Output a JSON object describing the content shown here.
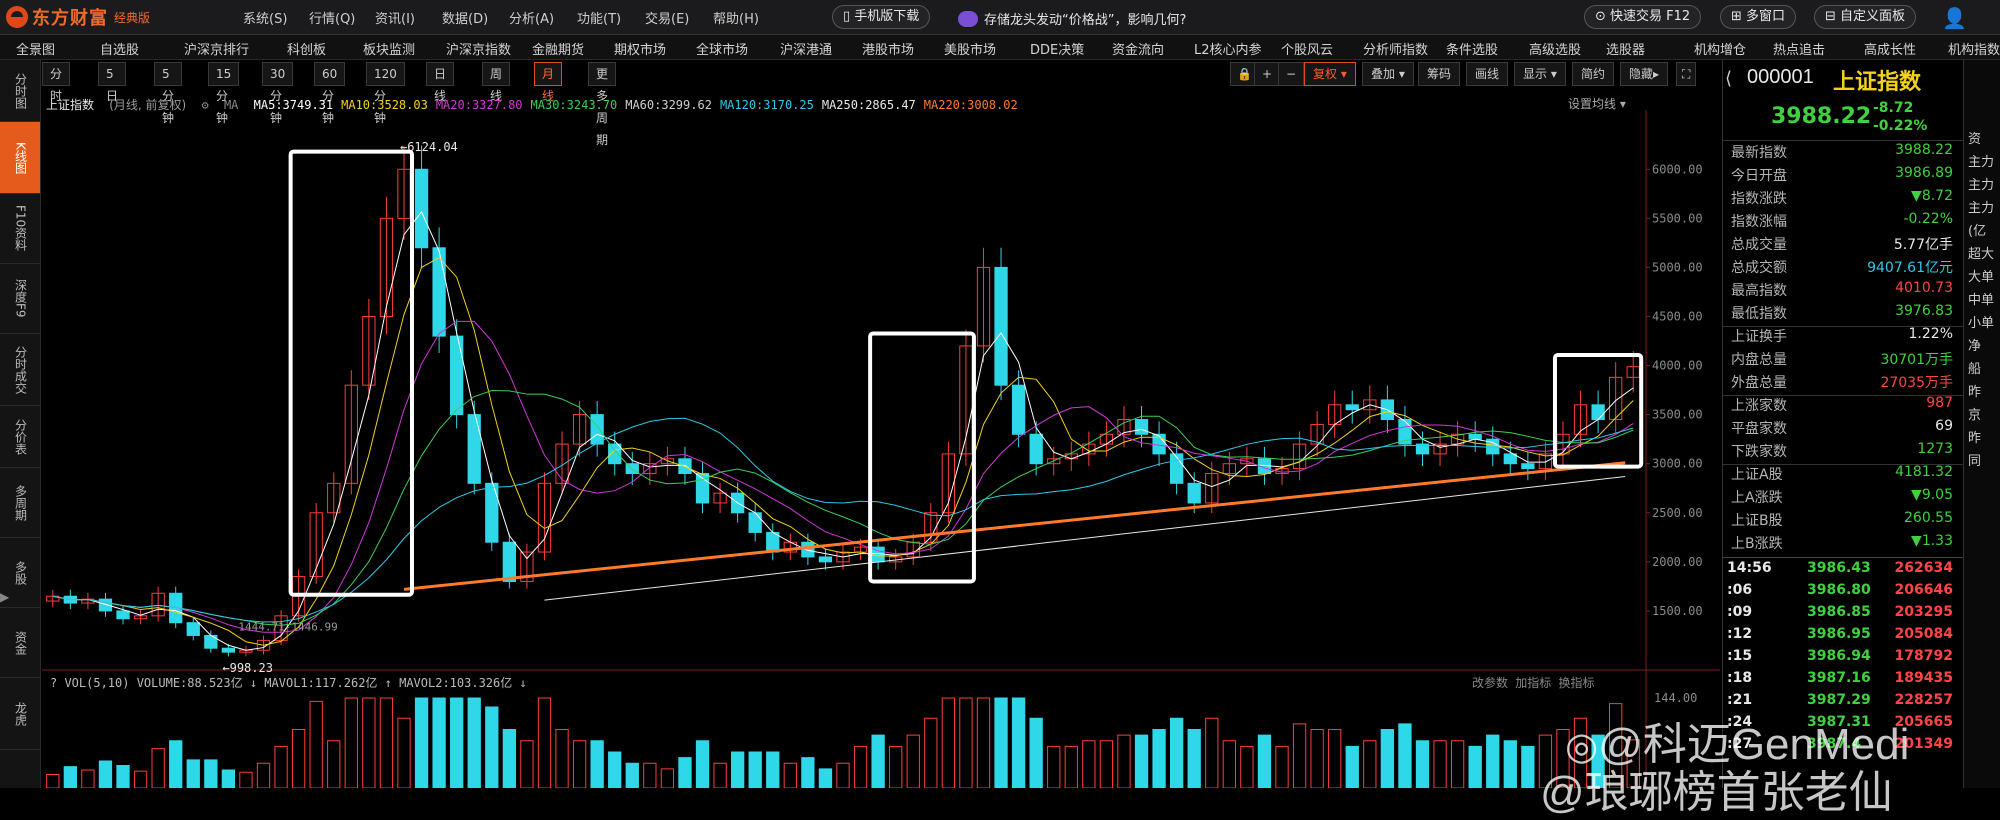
{
  "app": {
    "brand": "东方财富",
    "edition": "经典版",
    "menu": [
      "系统(S)",
      "行情(Q)",
      "资讯(I)",
      "数据(D)",
      "分析(A)",
      "功能(T)",
      "交易(E)",
      "帮助(H)"
    ],
    "mobile_download": "手机版下载",
    "news": "存储龙头发动“价格战”，影响几何?",
    "quick_trade": "快速交易 F12",
    "multi_window": "多窗口",
    "custom_panel": "自定义面板"
  },
  "nav2": [
    "全景图",
    "自选股",
    "沪深京排行",
    "科创板",
    "板块监测",
    "沪深京指数",
    "金融期货",
    "期权市场",
    "全球市场",
    "沪深港通",
    "港股市场",
    "美股市场",
    "DDE决策",
    "资金流向",
    "L2核心内参",
    "个股风云",
    "分析师指数",
    "条件选股",
    "高级选股",
    "选股器",
    "机构增仓",
    "热点追击",
    "高成长性",
    "机构指数"
  ],
  "left_tabs": [
    "分时图",
    "K线图",
    "F10资料",
    "深度F9",
    "分时成交",
    "分价表",
    "多周期",
    "多股",
    "资金",
    "龙虎"
  ],
  "left_tabs_active": 1,
  "periods": [
    "分时",
    "5日",
    "5分钟",
    "15分钟",
    "30分钟",
    "60分钟",
    "120分钟",
    "日线",
    "周线",
    "月线",
    "更多周期"
  ],
  "period_active": 9,
  "toolbar": {
    "fuquan": "复权",
    "overlay": "叠加",
    "chips": "筹码",
    "draw": "画线",
    "display": "显示",
    "simple": "简约",
    "hide": "隐藏"
  },
  "chart_header": {
    "name": "上证指数",
    "mode": "(月线, 前复权)",
    "ma_label": "MA",
    "ma": [
      {
        "label": "MA5:3749.31",
        "color": "#ffffff"
      },
      {
        "label": "MA10:3528.03",
        "color": "#f2d21b"
      },
      {
        "label": "MA20:3327.80",
        "color": "#d038d8"
      },
      {
        "label": "MA30:3243.70",
        "color": "#38d05a"
      },
      {
        "label": "MA60:3299.62",
        "color": "#cfcfcf"
      },
      {
        "label": "MA120:3170.25",
        "color": "#2fc8e8"
      },
      {
        "label": "MA250:2865.47",
        "color": "#e8e8e8"
      },
      {
        "label": "MA220:3008.02",
        "color": "#ff7a2a"
      }
    ],
    "settings": "设置均线"
  },
  "chart_data": {
    "type": "candlestick",
    "title": "上证指数",
    "period": "月线",
    "y_ticks": [
      6000,
      5500,
      5000,
      4500,
      4000,
      3500,
      3000,
      2500,
      2000,
      1500
    ],
    "ylim": [
      1000,
      6400
    ],
    "high_label": "6124.04",
    "low_label": "998.23",
    "other_label": "1444.71-1446.99",
    "close": [
      1650,
      1580,
      1620,
      1500,
      1420,
      1450,
      1680,
      1380,
      1250,
      1120,
      1080,
      1100,
      1200,
      1450,
      1850,
      2500,
      2800,
      3800,
      4500,
      5500,
      6000,
      5200,
      4300,
      3500,
      2800,
      2200,
      1800,
      2100,
      2800,
      3200,
      3500,
      3200,
      3000,
      2900,
      3000,
      3050,
      2900,
      2600,
      2700,
      2500,
      2300,
      2100,
      2200,
      2050,
      2000,
      2100,
      2150,
      2000,
      2050,
      2200,
      2500,
      3100,
      4200,
      5000,
      3800,
      3300,
      3000,
      3050,
      3100,
      3200,
      3300,
      3450,
      3300,
      3100,
      2800,
      2600,
      2900,
      3000,
      3050,
      2900,
      2950,
      3200,
      3400,
      3600,
      3550,
      3650,
      3450,
      3200,
      3100,
      3200,
      3300,
      3250,
      3100,
      3000,
      2950,
      3100,
      3300,
      3600,
      3450,
      3880,
      3988.22
    ],
    "volume_label": "VOL(5,10)",
    "volume_values": {
      "VOLUME": "88.523亿",
      "MAVOL1": "117.262亿",
      "MAVOL2": "103.326亿"
    },
    "volume_axis_top": "144.00",
    "volume_controls": [
      "改参数",
      "加指标",
      "换指标"
    ]
  },
  "quote": {
    "code": "000001",
    "name": "上证指数",
    "price": "3988.22",
    "change": "-8.72",
    "change_pct": "-0.22%",
    "rows": [
      {
        "k": "最新指数",
        "v": "3988.22",
        "c": "#3fd13f"
      },
      {
        "k": "今日开盘",
        "v": "3986.89",
        "c": "#3fd13f"
      },
      {
        "k": "指数涨跌",
        "v": "▼8.72",
        "c": "#3fd13f"
      },
      {
        "k": "指数涨幅",
        "v": "-0.22%",
        "c": "#3fd13f"
      },
      {
        "k": "总成交量",
        "v": "5.77亿手",
        "c": "#e8e8e8"
      },
      {
        "k": "总成交额",
        "v": "9407.61亿元",
        "c": "#2fc8e8"
      },
      {
        "k": "最高指数",
        "v": "4010.73",
        "c": "#ff4545"
      },
      {
        "k": "最低指数",
        "v": "3976.83",
        "c": "#3fd13f"
      },
      {
        "k": "上证换手",
        "v": "1.22%",
        "c": "#e8e8e8"
      },
      {
        "k": "内盘总量",
        "v": "30701万手",
        "c": "#3fd13f"
      },
      {
        "k": "外盘总量",
        "v": "27035万手",
        "c": "#ff4545"
      },
      {
        "k": "上涨家数",
        "v": "987",
        "c": "#ff4545"
      },
      {
        "k": "平盘家数",
        "v": "69",
        "c": "#e8e8e8"
      },
      {
        "k": "下跌家数",
        "v": "1273",
        "c": "#3fd13f"
      },
      {
        "k": "上证A股",
        "v": "4181.32",
        "c": "#3fd13f"
      },
      {
        "k": "上A涨跌",
        "v": "▼9.05",
        "c": "#3fd13f"
      },
      {
        "k": "上证B股",
        "v": "260.55",
        "c": "#3fd13f"
      },
      {
        "k": "上B涨跌",
        "v": "▼1.33",
        "c": "#3fd13f"
      }
    ],
    "ticks": [
      {
        "t": "14:56",
        "p": "3986.43",
        "v": "262634"
      },
      {
        "t": ":06",
        "p": "3986.80",
        "v": "206646"
      },
      {
        "t": ":09",
        "p": "3986.85",
        "v": "203295"
      },
      {
        "t": ":12",
        "p": "3986.95",
        "v": "205084"
      },
      {
        "t": ":15",
        "p": "3986.94",
        "v": "178792"
      },
      {
        "t": ":18",
        "p": "3987.16",
        "v": "189435"
      },
      {
        "t": ":21",
        "p": "3987.29",
        "v": "228257"
      },
      {
        "t": ":24",
        "p": "3987.31",
        "v": "205665"
      },
      {
        "t": ":27",
        "p": "3987.4",
        "v": "201349"
      }
    ]
  },
  "far_right": [
    "资",
    "主力",
    "主力",
    "主力",
    "(亿",
    "超大",
    "大单",
    "中单",
    "小单",
    "净",
    "船",
    "昨",
    "京",
    "昨",
    "同"
  ],
  "watermark": {
    "line1": "@科迈GenMedi",
    "line2": "@琅琊榜首张老仙"
  }
}
